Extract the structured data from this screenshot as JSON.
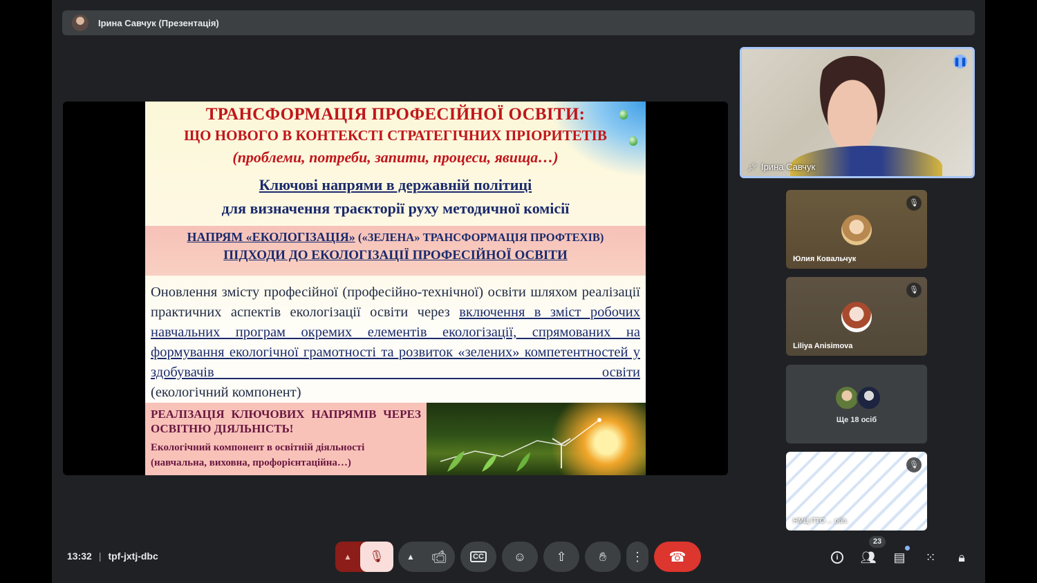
{
  "presenter_bar": {
    "title": "Ірина Савчук (Презентація)"
  },
  "slide": {
    "title_line1": "ТРАНСФОРМАЦІЯ ПРОФЕСІЙНОЇ ОСВІТИ:",
    "title_line2": "ЩО НОВОГО В КОНТЕКСТІ СТРАТЕГІЧНИХ ПРІОРИТЕТІВ",
    "title_line3": "(проблеми, потреби, запити, процеси, явища…)",
    "heading1": "Ключові напрями в державній політиці",
    "heading2": "для визначення траєкторії руху методичної комісії",
    "band_line1_a": "НАПРЯМ «ЕКОЛОГІЗАЦІЯ»",
    "band_line1_b": " («ЗЕЛЕНА» ТРАНСФОРМАЦІЯ ПРОФТЕХІВ)",
    "band_line2": "ПІДХОДИ ДО ЕКОЛОГІЗАЦІЇ ПРОФЕСІЙНОЇ ОСВІТИ",
    "body_plain": "Оновлення змісту професійної (професійно-технічної) освіти шляхом реалізації практичних аспектів екологізації освіти через",
    "body_underlined": "включення в зміст робочих навчальних програм окремих елементів екологізації, спрямованих на формування екологічної грамотності та розвиток «зелених» компетентностей у здобувачів освіти",
    "body_tail": "(екологічний компонент)",
    "bottom_title": "РЕАЛІЗАЦІЯ КЛЮЧОВИХ НАПРЯМІВ ЧЕРЕЗ ОСВІТНЮ ДІЯЛЬНІСТЬ!",
    "bottom_sub": "Екологічний компонент в освітній діяльності (навчальна, виховна, профорієнтаційна…)"
  },
  "participants": {
    "main": {
      "name": "Ірина Савчук"
    },
    "tiles": [
      {
        "name": "Юлия Ковальчук"
      },
      {
        "name": "Liliya Anisimova"
      },
      {
        "name": "Ще 18 осіб"
      },
      {
        "name": "НМЦ ПТО ... обл."
      }
    ]
  },
  "bottom_bar": {
    "time": "13:32",
    "separator": "|",
    "meeting_code": "tpf-jxtj-dbc",
    "cc_label": "CC",
    "people_count": "23"
  },
  "colors": {
    "background": "#202124",
    "leave_button": "#dc362e",
    "mic_off_bg": "#f9dedc",
    "active_speaker_border": "#a8c7fa"
  },
  "icons": [
    "mic-off-icon",
    "camera-icon",
    "captions-icon",
    "emoji-icon",
    "present-icon",
    "raise-hand-icon",
    "more-options-icon",
    "end-call-icon",
    "info-icon",
    "people-icon",
    "chat-icon",
    "activities-icon",
    "host-controls-icon"
  ]
}
